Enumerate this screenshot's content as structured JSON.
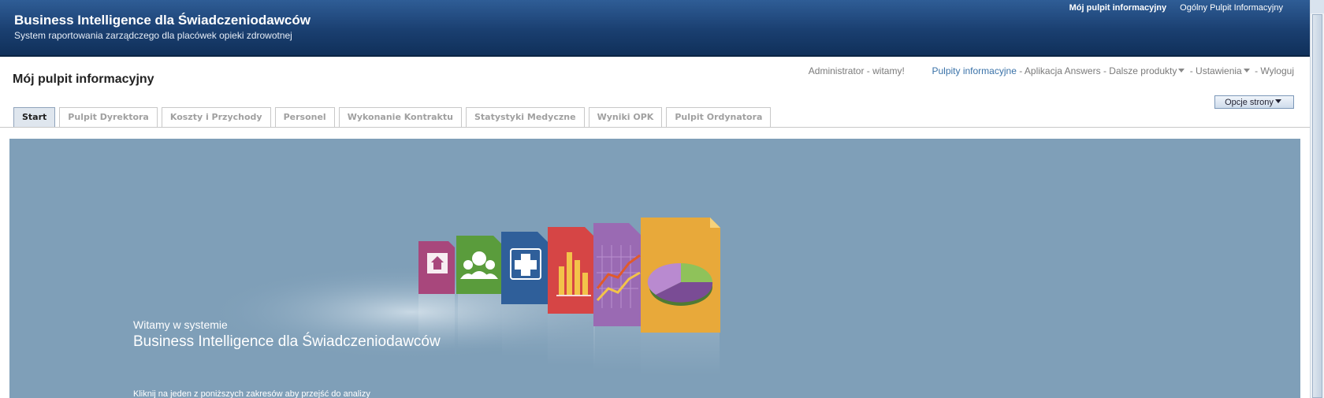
{
  "header": {
    "title": "Business Intelligence dla Świadczeniodawców",
    "subtitle": "System raportowania zarządczego dla placówek opieki zdrowotnej",
    "links": [
      "Mój pulpit informacyjny",
      "Ogólny Pulpit Informacyjny"
    ]
  },
  "page_title": "Mój pulpit informacyjny",
  "user_greeting": "Administrator - witamy!",
  "nav": {
    "dashboards": "Pulpity informacyjne",
    "answers": "Aplikacja Answers",
    "more": "Dalsze produkty",
    "settings": "Ustawienia",
    "logout": "Wyloguj",
    "separator": "-"
  },
  "page_options_label": "Opcje strony",
  "tabs": [
    "Start",
    "Pulpit Dyrektora",
    "Koszty i Przychody",
    "Personel",
    "Wykonanie Kontraktu",
    "Statystyki Medyczne",
    "Wyniki OPK",
    "Pulpit Ordynatora"
  ],
  "active_tab": 0,
  "welcome": {
    "line1": "Witamy w systemie",
    "line2": "Business Intelligence dla Świadczeniodawców",
    "line3": "Kliknij na jeden z poniższych zakresów aby przejść do analizy"
  },
  "hero_icons": [
    "home-icon",
    "people-icon",
    "medical-cross-icon",
    "bar-chart-icon",
    "line-chart-icon",
    "pie-chart-icon"
  ],
  "colors": {
    "header_bg": "#1a3f70",
    "hero_bg": "#7f9fb8",
    "accent_link": "#3a72a8"
  }
}
